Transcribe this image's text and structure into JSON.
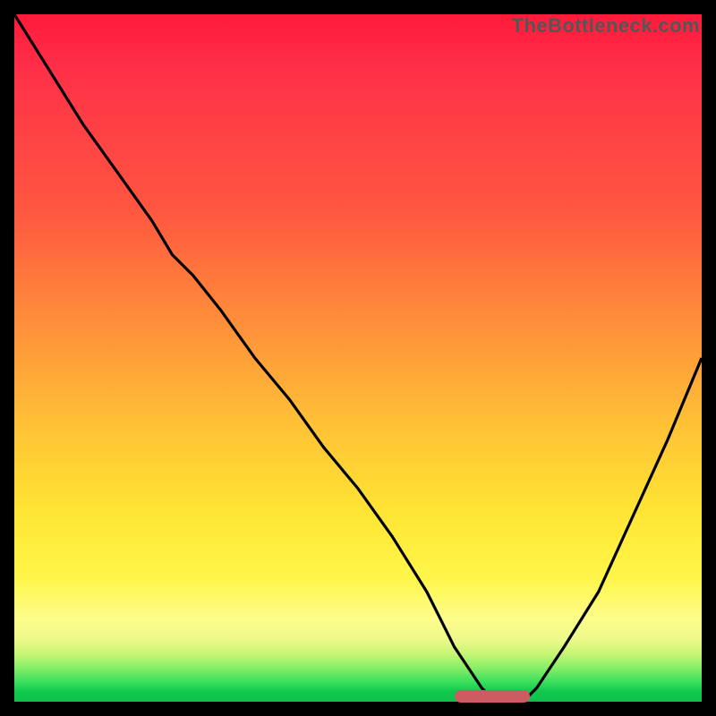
{
  "watermark": "TheBottleneck.com",
  "colors": {
    "frame": "#000000",
    "marker": "#cc5b62",
    "curve_stroke": "#000000",
    "gradient_top": "#ff1a3a",
    "gradient_bottom": "#0fbf4c"
  },
  "chart_data": {
    "type": "line",
    "title": "",
    "xlabel": "",
    "ylabel": "",
    "xlim": [
      0,
      100
    ],
    "ylim": [
      0,
      100
    ],
    "grid": false,
    "x": [
      0,
      5,
      10,
      15,
      20,
      23,
      26,
      30,
      35,
      40,
      45,
      50,
      55,
      60,
      62,
      64,
      66,
      68,
      70,
      72,
      74,
      76,
      80,
      85,
      90,
      95,
      100
    ],
    "values": [
      100,
      92,
      84,
      77,
      70,
      65,
      62,
      57,
      50,
      44,
      37,
      31,
      24,
      16,
      12,
      8,
      5,
      2,
      0,
      0,
      0,
      2,
      8,
      16,
      27,
      38,
      50
    ],
    "annotations": [
      {
        "name": "sweet-spot-marker",
        "x_start": 64,
        "x_end": 75,
        "y": 0
      }
    ]
  }
}
